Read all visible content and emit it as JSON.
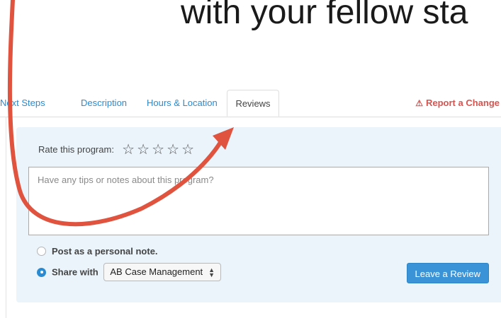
{
  "headline": "with your fellow sta",
  "tabs": [
    {
      "label": "Next Steps",
      "active": false
    },
    {
      "label": "Description",
      "active": false
    },
    {
      "label": "Hours & Location",
      "active": false
    },
    {
      "label": "Reviews",
      "active": true
    }
  ],
  "report": {
    "icon": "warning-icon",
    "label": "Report a Change",
    "color": "#d9534f"
  },
  "review_form": {
    "rate_label": "Rate this program:",
    "stars_total": 5,
    "stars_selected": 0,
    "notes_placeholder": "Have any tips or notes about this program?",
    "notes_value": "",
    "personal_note_label": "Post as a personal note.",
    "personal_note_selected": false,
    "share_with_label": "Share with",
    "share_with_selected": true,
    "share_with_value": "AB Case Management",
    "submit_label": "Leave a Review"
  },
  "colors": {
    "link": "#2a8bd2",
    "panel_bg": "#eaf4fa",
    "button_bg": "#3a93d6",
    "annotation_arrow": "#e0533f"
  }
}
